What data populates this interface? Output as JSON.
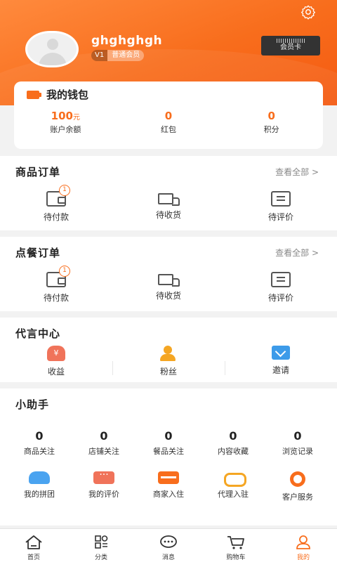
{
  "profile": {
    "username": "ghghghgh",
    "level": "V1",
    "member_type": "普通会员",
    "vip_card": "会员卡"
  },
  "wallet": {
    "title": "我的钱包",
    "items": [
      {
        "value": "100",
        "unit": "元",
        "label": "账户余额"
      },
      {
        "value": "0",
        "label": "红包"
      },
      {
        "value": "0",
        "label": "积分"
      }
    ]
  },
  "goods_orders": {
    "title": "商品订单",
    "more": "查看全部 >",
    "items": [
      {
        "label": "待付款",
        "badge": "1"
      },
      {
        "label": "待收货"
      },
      {
        "label": "待评价"
      }
    ]
  },
  "food_orders": {
    "title": "点餐订单",
    "more": "查看全部 >",
    "items": [
      {
        "label": "待付款",
        "badge": "1"
      },
      {
        "label": "待收货"
      },
      {
        "label": "待评价"
      }
    ]
  },
  "spokesman": {
    "title": "代言中心",
    "items": [
      {
        "label": "收益",
        "icon": "money-bag-icon",
        "icon_text": "¥"
      },
      {
        "label": "粉丝",
        "icon": "fans-icon"
      },
      {
        "label": "邀请",
        "icon": "invite-icon"
      }
    ]
  },
  "assistant": {
    "title": "小助手",
    "stats": [
      {
        "value": "0",
        "label": "商品关注"
      },
      {
        "value": "0",
        "label": "店铺关注"
      },
      {
        "value": "0",
        "label": "餐品关注"
      },
      {
        "value": "0",
        "label": "内容收藏"
      },
      {
        "value": "0",
        "label": "浏览记录"
      }
    ],
    "tools": [
      {
        "label": "我的拼团",
        "icon": "group-buy-icon"
      },
      {
        "label": "我的评价",
        "icon": "review-icon"
      },
      {
        "label": "商家入住",
        "icon": "merchant-icon"
      },
      {
        "label": "代理入驻",
        "icon": "handshake-icon"
      },
      {
        "label": "客户服务",
        "icon": "customer-service-icon"
      }
    ]
  },
  "tabbar": {
    "items": [
      {
        "label": "首页",
        "icon": "home-icon"
      },
      {
        "label": "分类",
        "icon": "category-icon"
      },
      {
        "label": "消息",
        "icon": "message-icon"
      },
      {
        "label": "购物车",
        "icon": "cart-icon"
      },
      {
        "label": "我的",
        "icon": "profile-icon",
        "active": true
      }
    ]
  },
  "colors": {
    "accent": "#f86d1c",
    "background": "#f2f2f2"
  }
}
